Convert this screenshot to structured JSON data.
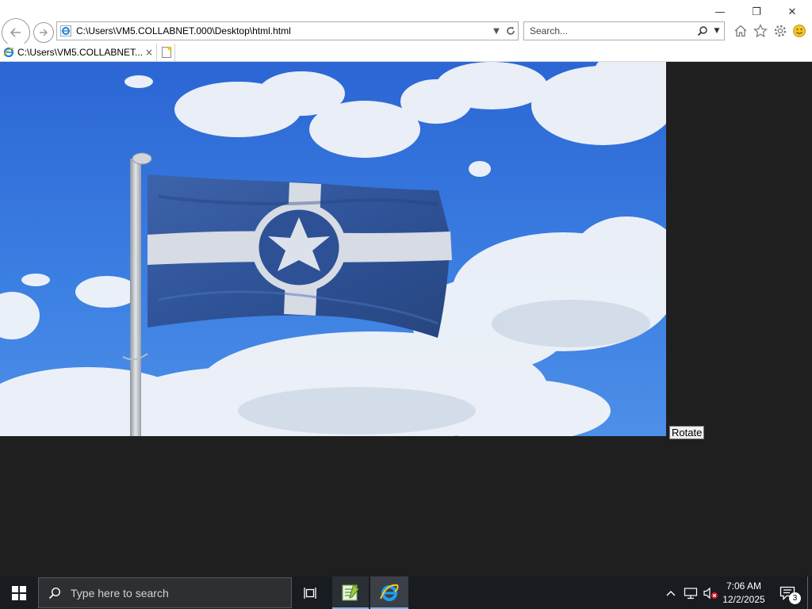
{
  "browser": {
    "address": "C:\\Users\\VM5.COLLABNET.000\\Desktop\\html.html",
    "search_placeholder": "Search...",
    "tab_title": "C:\\Users\\VM5.COLLABNET....",
    "tab_close": "×"
  },
  "window_controls": {
    "minimize": "—",
    "restore": "❐",
    "close": "✕"
  },
  "page": {
    "image_subject": "waving flag with star emblem against blue sky",
    "rotate_label": "Rotate"
  },
  "taskbar": {
    "search_placeholder": "Type here to search",
    "clock_time": "7:06 AM",
    "clock_date": "12/2/2025",
    "notification_count": "3"
  },
  "colors": {
    "sky": "#2f6fd6",
    "flag_blue": "#34589e",
    "flag_white": "#d8dde8",
    "taskbar": "#181c21",
    "accent": "#76b9ed"
  }
}
